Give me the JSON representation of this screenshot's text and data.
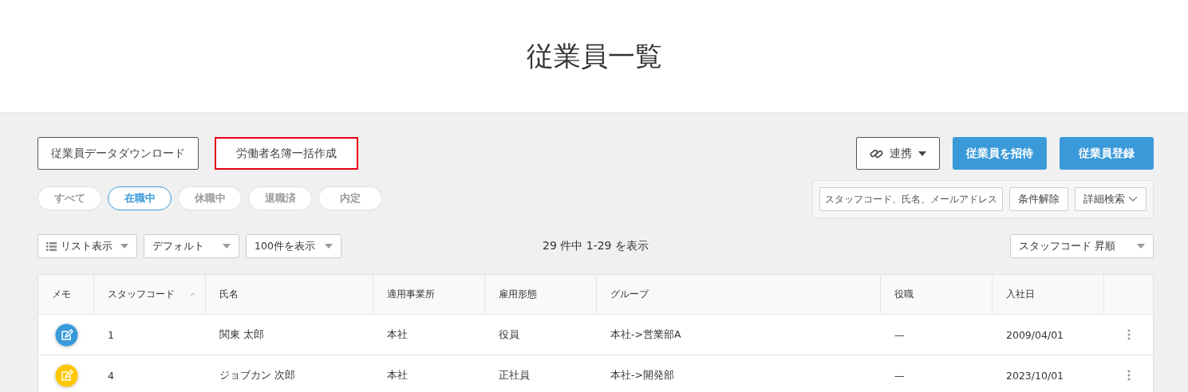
{
  "page_title": "従業員一覧",
  "left_actions": [
    {
      "label": "従業員データダウンロード",
      "highlighted": false
    },
    {
      "label": "労働者名簿一括作成",
      "highlighted": true
    }
  ],
  "link_menu": {
    "label": "連携"
  },
  "primary_actions": [
    "従業員を招待",
    "従業員登録"
  ],
  "status_filters": [
    {
      "label": "すべて",
      "selected": false
    },
    {
      "label": "在職中",
      "selected": true
    },
    {
      "label": "休職中",
      "selected": false
    },
    {
      "label": "退職済",
      "selected": false
    },
    {
      "label": "内定",
      "selected": false
    }
  ],
  "search": {
    "placeholder": "スタッフコード、氏名、メールアドレス",
    "clear_label": "条件解除",
    "advanced_label": "詳細検索"
  },
  "view_selects": [
    {
      "kind": "list",
      "label": "リスト表示"
    },
    {
      "kind": "plain",
      "label": "デフォルト"
    },
    {
      "kind": "plain",
      "label": "100件を表示"
    }
  ],
  "result_count": "29 件中 1-29 を表示",
  "sort_select": "スタッフコード 昇順",
  "table": {
    "columns": [
      {
        "label": "メモ",
        "sorted": false
      },
      {
        "label": "スタッフコード",
        "sorted": true
      },
      {
        "label": "氏名",
        "sorted": false
      },
      {
        "label": "適用事業所",
        "sorted": false
      },
      {
        "label": "雇用形態",
        "sorted": false
      },
      {
        "label": "グループ",
        "sorted": false
      },
      {
        "label": "役職",
        "sorted": false
      },
      {
        "label": "入社日",
        "sorted": false
      }
    ],
    "rows": [
      {
        "color": "#3a9ad9",
        "cells": [
          "",
          "1",
          "関東 太郎",
          "本社",
          "役員",
          "本社->営業部A",
          "—",
          "2009/04/01"
        ]
      },
      {
        "color": "#ffc700",
        "cells": [
          "",
          "4",
          "ジョブカン 次郎",
          "本社",
          "正社員",
          "本社->開発部",
          "—",
          "2023/10/01"
        ]
      }
    ]
  }
}
